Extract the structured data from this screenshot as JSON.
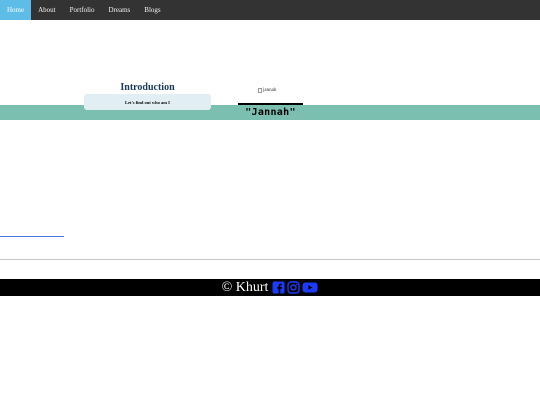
{
  "nav": {
    "items": [
      {
        "label": "Home",
        "active": true
      },
      {
        "label": "About",
        "active": false
      },
      {
        "label": "Portfolio",
        "active": false
      },
      {
        "label": "Dreams",
        "active": false
      },
      {
        "label": "Blogs",
        "active": false
      }
    ]
  },
  "intro": {
    "title": "Introduction",
    "subtitle": "Let's find out who am I"
  },
  "profile": {
    "image_alt": "jannah",
    "name": "\"Jannah\""
  },
  "footer": {
    "copyright": "© Khurt",
    "social_icons": [
      "facebook-icon",
      "instagram-icon",
      "youtube-icon"
    ],
    "icon_color": "#1a3cff"
  },
  "colors": {
    "navbar_bg": "#333333",
    "nav_active": "#5dbde6",
    "band": "#7bbfb0",
    "intro_box": "#e1eff5",
    "title_color": "#1b3a5c"
  }
}
